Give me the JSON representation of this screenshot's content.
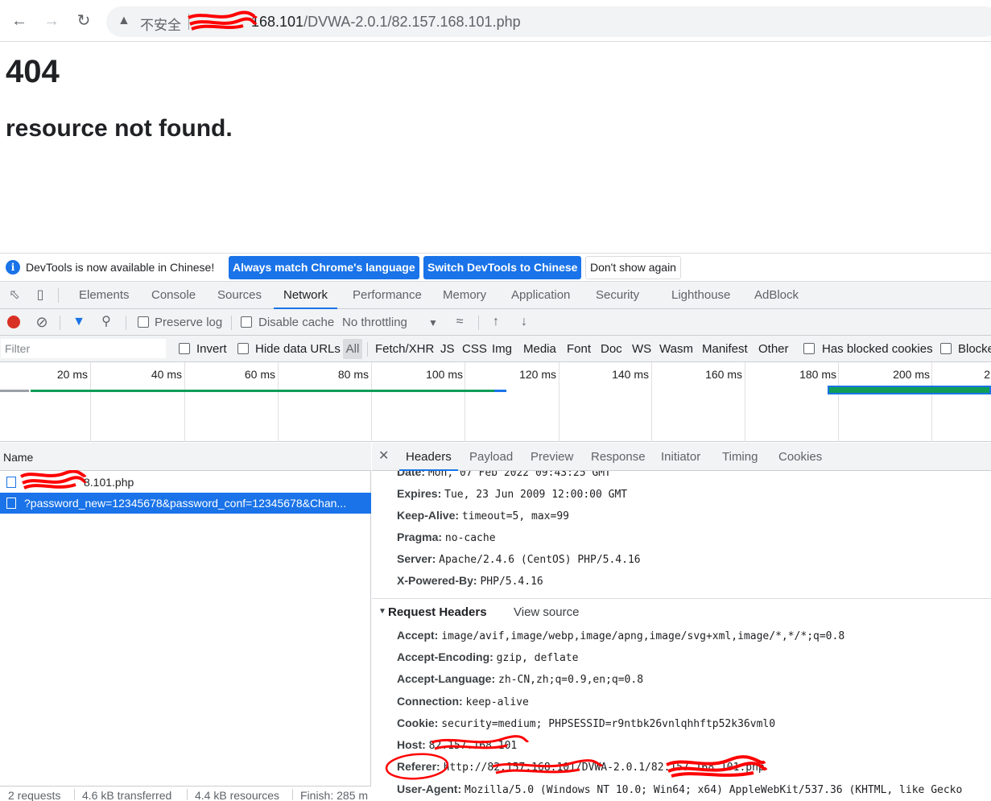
{
  "browser": {
    "insecure_label": "不安全",
    "url_visible_part": "168.101",
    "url_path": "/DVWA-2.0.1/82.157.168.101.php"
  },
  "page": {
    "heading": "404",
    "message": "resource not found."
  },
  "devtools_infobar": {
    "text": "DevTools is now available in Chinese!",
    "btn_match": "Always match Chrome's language",
    "btn_switch": "Switch DevTools to Chinese",
    "btn_dismiss": "Don't show again"
  },
  "devtools_tabs": [
    "Elements",
    "Console",
    "Sources",
    "Network",
    "Performance",
    "Memory",
    "Application",
    "Security",
    "Lighthouse",
    "AdBlock"
  ],
  "network_toolbar": {
    "preserve_log": "Preserve log",
    "disable_cache": "Disable cache",
    "throttling": "No throttling"
  },
  "filter_bar": {
    "placeholder": "Filter",
    "invert": "Invert",
    "hide_data_urls": "Hide data URLs",
    "all": "All",
    "types": [
      "Fetch/XHR",
      "JS",
      "CSS",
      "Img",
      "Media",
      "Font",
      "Doc",
      "WS",
      "Wasm",
      "Manifest",
      "Other"
    ],
    "has_blocked_cookies": "Has blocked cookies",
    "blocked": "Blocke"
  },
  "timeline": {
    "ticks": [
      "20 ms",
      "40 ms",
      "60 ms",
      "80 ms",
      "100 ms",
      "120 ms",
      "140 ms",
      "160 ms",
      "180 ms",
      "200 ms",
      "2"
    ]
  },
  "requests": {
    "column_name": "Name",
    "rows": [
      {
        "name": "8.101.php"
      },
      {
        "name": "?password_new=12345678&password_conf=12345678&Chan..."
      }
    ],
    "status": {
      "requests": "2 requests",
      "transferred": "4.6 kB transferred",
      "resources": "4.4 kB resources",
      "finish": "Finish: 285 m"
    }
  },
  "detail_tabs": [
    "Headers",
    "Payload",
    "Preview",
    "Response",
    "Initiator",
    "Timing",
    "Cookies"
  ],
  "response_headers": [
    {
      "name": "Date:",
      "value": "Mon, 07 Feb 2022 09:43:25 GMT"
    },
    {
      "name": "Expires:",
      "value": "Tue, 23 Jun 2009 12:00:00 GMT"
    },
    {
      "name": "Keep-Alive:",
      "value": "timeout=5, max=99"
    },
    {
      "name": "Pragma:",
      "value": "no-cache"
    },
    {
      "name": "Server:",
      "value": "Apache/2.4.6 (CentOS) PHP/5.4.16"
    },
    {
      "name": "X-Powered-By:",
      "value": "PHP/5.4.16"
    }
  ],
  "request_headers_section": {
    "title": "Request Headers",
    "view_source": "View source"
  },
  "request_headers": [
    {
      "name": "Accept:",
      "value": "image/avif,image/webp,image/apng,image/svg+xml,image/*,*/*;q=0.8"
    },
    {
      "name": "Accept-Encoding:",
      "value": "gzip, deflate"
    },
    {
      "name": "Accept-Language:",
      "value": "zh-CN,zh;q=0.9,en;q=0.8"
    },
    {
      "name": "Connection:",
      "value": "keep-alive"
    },
    {
      "name": "Cookie:",
      "value": "security=medium; PHPSESSID=r9ntbk26vnlqhhftp52k36vml0"
    },
    {
      "name": "Host:",
      "value": "82.157.168.101"
    },
    {
      "name": "Referer:",
      "value": "http://82.157.168.101/DVWA-2.0.1/82.157.168.101.php"
    },
    {
      "name": "User-Agent:",
      "value": "Mozilla/5.0 (Windows NT 10.0; Win64; x64) AppleWebKit/537.36 (KHTML, like Gecko"
    }
  ],
  "annotation_color": "#ff0000",
  "accent_color": "#1a73e8"
}
